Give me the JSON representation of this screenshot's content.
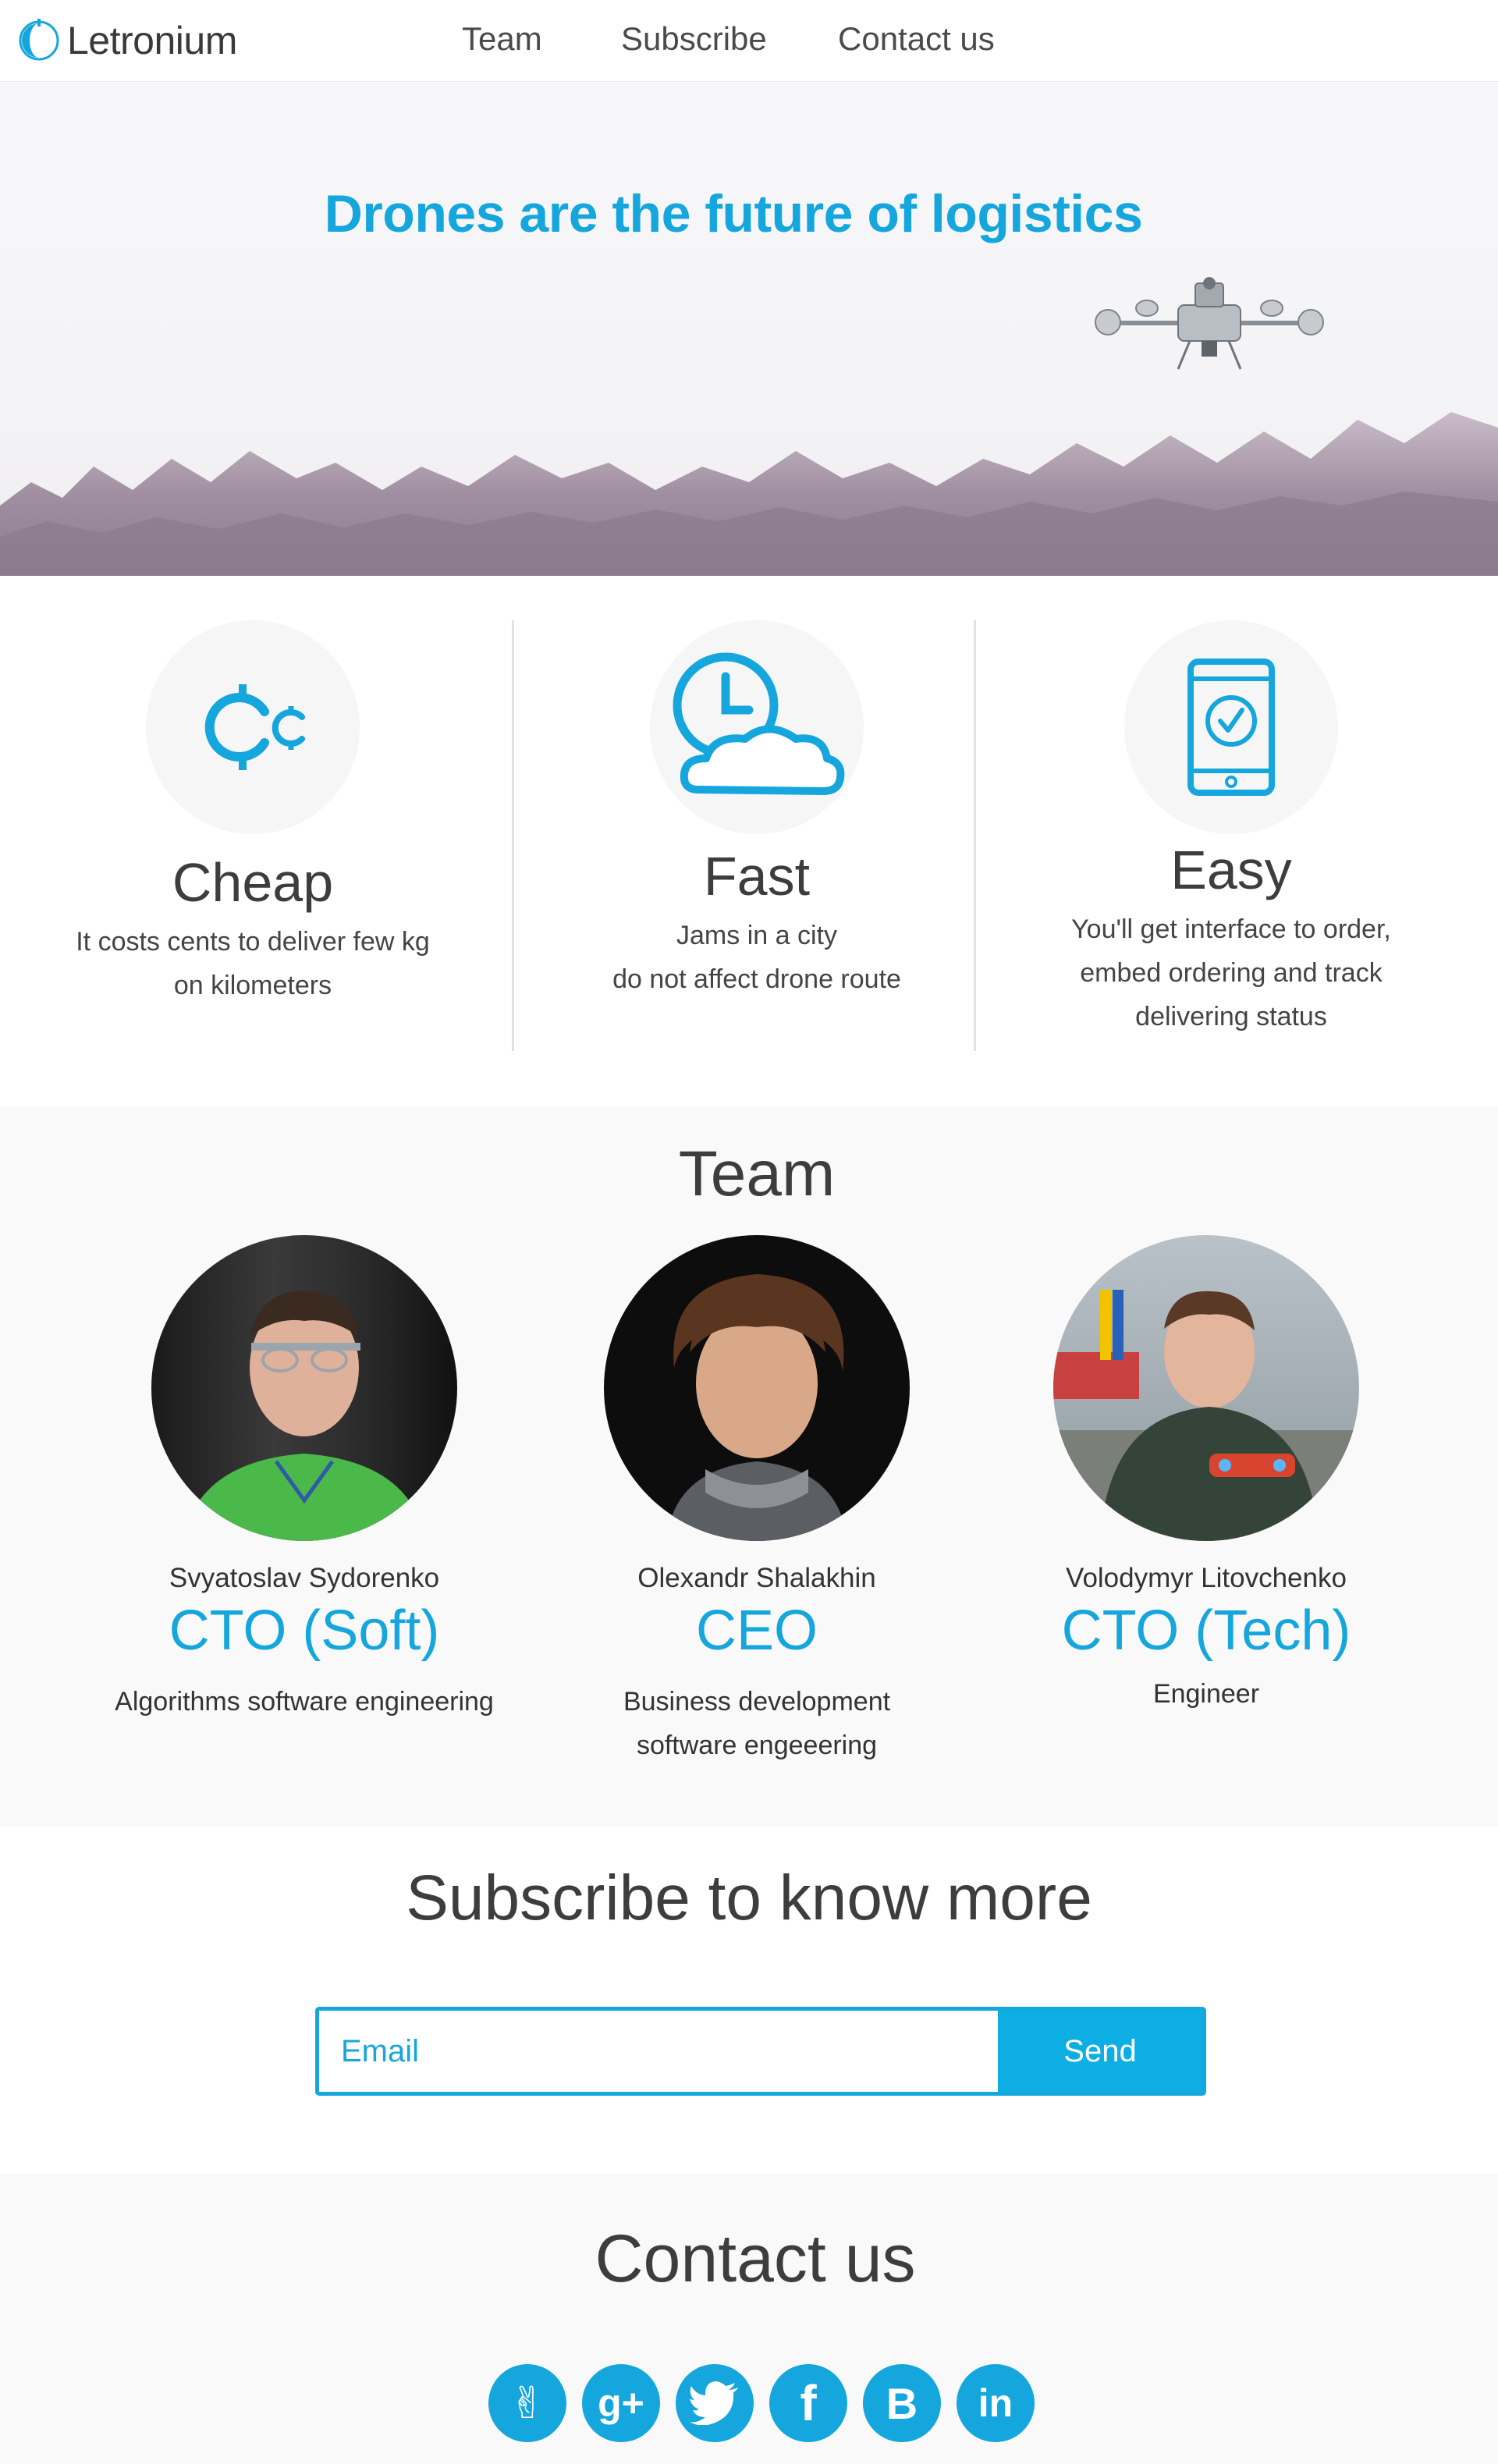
{
  "nav": {
    "logo_text": "Letronium",
    "links": [
      {
        "label": "Team"
      },
      {
        "label": "Subscribe"
      },
      {
        "label": "Contact us"
      }
    ]
  },
  "hero": {
    "title": "Drones are the future of logistics"
  },
  "features": [
    {
      "title": "Cheap",
      "desc_lines": [
        "It costs cents to deliver few kg",
        "on kilometers"
      ],
      "icon": "cent-icon"
    },
    {
      "title": "Fast",
      "desc_lines": [
        "Jams in a city",
        "do not affect drone route"
      ],
      "icon": "clock-cloud-icon"
    },
    {
      "title": "Easy",
      "desc_lines": [
        "You'll get interface to order,",
        "embed ordering and track",
        "delivering status"
      ],
      "icon": "smartphone-check-icon"
    }
  ],
  "team": {
    "heading": "Team",
    "members": [
      {
        "name": "Svyatoslav Sydorenko",
        "role": "CTO (Soft)",
        "desc_lines": [
          "Algorithms software engineering"
        ]
      },
      {
        "name": "Olexandr Shalakhin",
        "role": "CEO",
        "desc_lines": [
          "Business development",
          "software engeeering"
        ]
      },
      {
        "name": "Volodymyr Litovchenko",
        "role": "CTO (Tech)",
        "desc_lines": [
          "Engineer"
        ]
      }
    ]
  },
  "subscribe": {
    "heading": "Subscribe to know more",
    "placeholder": "Email",
    "button": "Send"
  },
  "contact": {
    "heading": "Contact us",
    "social_icons": [
      "angellist-icon",
      "google-plus-icon",
      "twitter-icon",
      "facebook-icon",
      "behance-icon",
      "linkedin-icon"
    ],
    "social_glyphs": [
      "✌",
      "g+",
      "",
      "f",
      "B",
      "in"
    ]
  },
  "colors": {
    "accent": "#14a6dc",
    "text": "#3d3d3d"
  }
}
